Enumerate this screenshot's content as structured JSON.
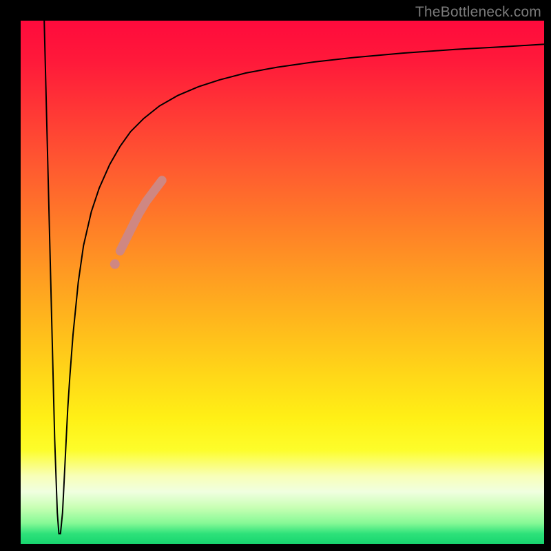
{
  "watermark": "TheBottleneck.com",
  "chart_data": {
    "type": "line",
    "title": "",
    "xlabel": "",
    "ylabel": "",
    "xlim": [
      0,
      100
    ],
    "ylim": [
      0,
      100
    ],
    "background_gradient_stops": [
      {
        "pos": 0.0,
        "color": "#ff0a3c"
      },
      {
        "pos": 0.5,
        "color": "#ffb91c"
      },
      {
        "pos": 0.8,
        "color": "#fdfd2a"
      },
      {
        "pos": 1.0,
        "color": "#17d46e"
      }
    ],
    "series": [
      {
        "name": "bottleneck-curve",
        "color": "#000000",
        "x": [
          4.5,
          5.0,
          5.5,
          6.0,
          6.5,
          7.0,
          7.3,
          7.6,
          8.0,
          8.3,
          8.7,
          9.0,
          9.4,
          10.0,
          11.0,
          12.0,
          13.5,
          15.0,
          17.0,
          19.0,
          21.0,
          23.5,
          26.5,
          30.0,
          34.0,
          38.0,
          43.0,
          49.0,
          56.0,
          64.0,
          73.0,
          83.0,
          92.0,
          100.0
        ],
        "y": [
          100.0,
          80.0,
          60.0,
          40.0,
          20.0,
          6.0,
          2.0,
          2.0,
          6.0,
          12.0,
          20.0,
          26.0,
          32.0,
          40.0,
          50.0,
          57.0,
          63.5,
          68.0,
          72.5,
          76.0,
          78.8,
          81.3,
          83.7,
          85.7,
          87.4,
          88.7,
          90.0,
          91.1,
          92.1,
          93.0,
          93.8,
          94.5,
          95.0,
          95.5
        ]
      }
    ],
    "highlight_segment": {
      "name": "marked-range",
      "color": "#cf8782",
      "thickness_px": 13,
      "x": [
        19.0,
        20.0,
        21.0,
        22.5,
        24.0,
        25.5,
        27.0
      ],
      "y": [
        56.0,
        58.0,
        60.0,
        63.0,
        65.5,
        67.5,
        69.5
      ]
    },
    "highlight_dot": {
      "name": "marked-dot",
      "color": "#cf8782",
      "radius_px": 7,
      "x": 18.0,
      "y": 53.5
    }
  }
}
